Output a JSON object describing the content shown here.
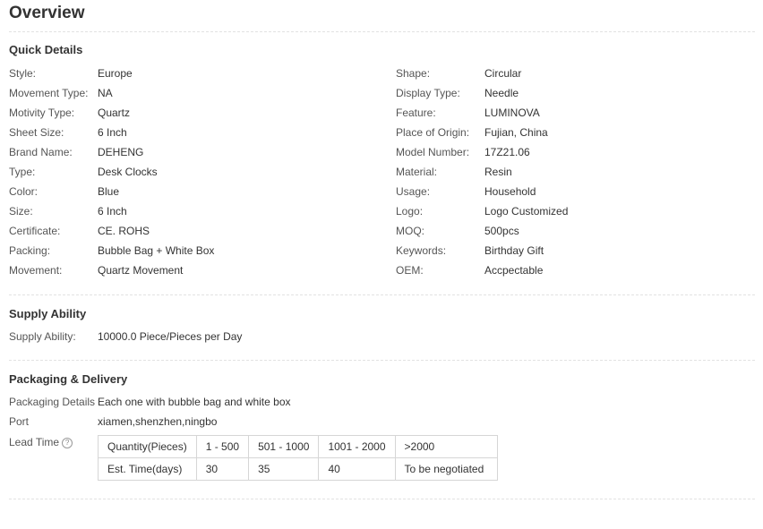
{
  "page": {
    "title": "Overview"
  },
  "quick_details": {
    "title": "Quick Details",
    "left": [
      {
        "label": "Style:",
        "value": "Europe"
      },
      {
        "label": "Movement Type:",
        "value": "NA"
      },
      {
        "label": "Motivity Type:",
        "value": "Quartz"
      },
      {
        "label": "Sheet Size:",
        "value": "6 Inch"
      },
      {
        "label": "Brand Name:",
        "value": "DEHENG"
      },
      {
        "label": "Type:",
        "value": "Desk Clocks"
      },
      {
        "label": "Color:",
        "value": "Blue"
      },
      {
        "label": "Size:",
        "value": "6 Inch"
      },
      {
        "label": "Certificate:",
        "value": "CE. ROHS"
      },
      {
        "label": "Packing:",
        "value": "Bubble Bag + White Box"
      },
      {
        "label": "Movement:",
        "value": "Quartz Movement"
      }
    ],
    "right": [
      {
        "label": "Shape:",
        "value": "Circular"
      },
      {
        "label": "Display Type:",
        "value": "Needle"
      },
      {
        "label": "Feature:",
        "value": "LUMINOVA"
      },
      {
        "label": "Place of Origin:",
        "value": "Fujian, China"
      },
      {
        "label": "Model Number:",
        "value": "17Z21.06"
      },
      {
        "label": "Material:",
        "value": "Resin"
      },
      {
        "label": "Usage:",
        "value": "Household"
      },
      {
        "label": "Logo:",
        "value": "Logo Customized"
      },
      {
        "label": "MOQ:",
        "value": "500pcs"
      },
      {
        "label": "Keywords:",
        "value": "Birthday Gift"
      },
      {
        "label": "OEM:",
        "value": "Accpectable"
      }
    ]
  },
  "supply_ability": {
    "title": "Supply Ability",
    "label": "Supply Ability:",
    "value": "10000.0 Piece/Pieces per Day"
  },
  "packaging_delivery": {
    "title": "Packaging & Delivery",
    "details_label": "Packaging Details",
    "details_value": "Each one with bubble bag and white box",
    "port_label": "Port",
    "port_value": "xiamen,shenzhen,ningbo",
    "lead_time_label": "Lead Time",
    "help_icon": "question-icon",
    "lead_table": {
      "rows": [
        [
          "Quantity(Pieces)",
          "1 - 500",
          "501 - 1000",
          "1001 - 2000",
          ">2000"
        ],
        [
          "Est. Time(days)",
          "30",
          "35",
          "40",
          "To be negotiated"
        ]
      ]
    }
  },
  "colors": {
    "text": "#333333",
    "label": "#555555",
    "border": "#d6d6d6",
    "divider": "#e2e2e2"
  }
}
